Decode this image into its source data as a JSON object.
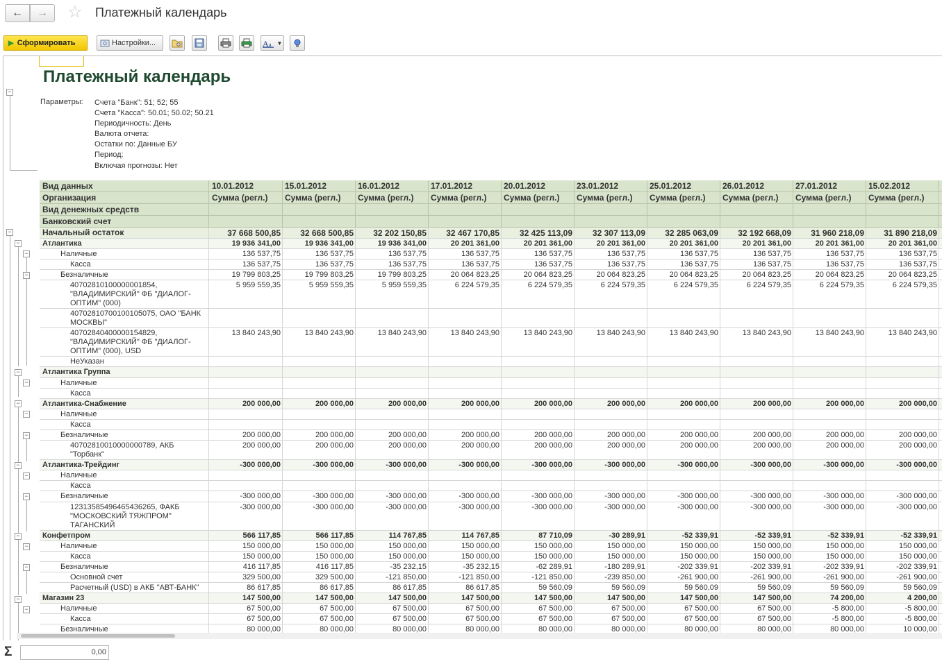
{
  "window": {
    "title": "Платежный календарь",
    "back_icon": "←",
    "fwd_icon": "→",
    "star_icon": "☆"
  },
  "toolbar": {
    "form_label": "Сформировать",
    "settings_label": "Настройки..."
  },
  "report": {
    "title": "Платежный календарь",
    "params_label": "Параметры:",
    "params": [
      "Счета \"Банк\": 51; 52; 55",
      "Счета \"Касса\": 50.01; 50.02; 50.21",
      "Периодичность: День",
      "Валюта отчета:",
      "Остатки по: Данные БУ",
      "Период:",
      "Включая прогнозы: Нет"
    ],
    "header": {
      "labels": [
        "Вид данных",
        "Организация",
        "Вид денежных средств",
        "Банковский счет"
      ],
      "dates": [
        "10.01.2012",
        "15.01.2012",
        "16.01.2012",
        "17.01.2012",
        "20.01.2012",
        "23.01.2012",
        "25.01.2012",
        "26.01.2012",
        "27.01.2012",
        "15.02.2012"
      ],
      "sum_label": "Сумма (регл.)"
    },
    "rows": [
      {
        "label": "Начальный остаток",
        "type": "tot",
        "values": [
          "37 668 500,85",
          "32 668 500,85",
          "32 202 150,85",
          "32 467 170,85",
          "32 425 113,09",
          "32 307 113,09",
          "32 285 063,09",
          "32 192 668,09",
          "31 960 218,09",
          "31 890 218,09"
        ]
      },
      {
        "label": "Атлантика",
        "type": "org",
        "values": [
          "19 936 341,00",
          "19 936 341,00",
          "19 936 341,00",
          "20 201 361,00",
          "20 201 361,00",
          "20 201 361,00",
          "20 201 361,00",
          "20 201 361,00",
          "20 201 361,00",
          "20 201 361,00"
        ]
      },
      {
        "label": "Наличные",
        "type": "sub",
        "values": [
          "136 537,75",
          "136 537,75",
          "136 537,75",
          "136 537,75",
          "136 537,75",
          "136 537,75",
          "136 537,75",
          "136 537,75",
          "136 537,75",
          "136 537,75"
        ]
      },
      {
        "label": "Касса",
        "type": "det",
        "values": [
          "136 537,75",
          "136 537,75",
          "136 537,75",
          "136 537,75",
          "136 537,75",
          "136 537,75",
          "136 537,75",
          "136 537,75",
          "136 537,75",
          "136 537,75"
        ]
      },
      {
        "label": "Безналичные",
        "type": "sub",
        "values": [
          "19 799 803,25",
          "19 799 803,25",
          "19 799 803,25",
          "20 064 823,25",
          "20 064 823,25",
          "20 064 823,25",
          "20 064 823,25",
          "20 064 823,25",
          "20 064 823,25",
          "20 064 823,25"
        ]
      },
      {
        "label": "40702810100000001854, \"ВЛАДИМИРСКИЙ\" ФБ \"ДИАЛОГ-ОПТИМ\" (000)",
        "type": "det",
        "lines": 3,
        "values": [
          "5 959 559,35",
          "5 959 559,35",
          "5 959 559,35",
          "6 224 579,35",
          "6 224 579,35",
          "6 224 579,35",
          "6 224 579,35",
          "6 224 579,35",
          "6 224 579,35",
          "6 224 579,35"
        ]
      },
      {
        "label": "40702810700100105075, ОАО \"БАНК МОСКВЫ\"",
        "type": "det",
        "lines": 2,
        "values": [
          "",
          "",
          "",
          "",
          "",
          "",
          "",
          "",
          "",
          ""
        ]
      },
      {
        "label": "40702840400000154829, \"ВЛАДИМИРСКИЙ\" ФБ \"ДИАЛОГ-ОПТИМ\" (000), USD",
        "type": "det",
        "lines": 3,
        "values": [
          "13 840 243,90",
          "13 840 243,90",
          "13 840 243,90",
          "13 840 243,90",
          "13 840 243,90",
          "13 840 243,90",
          "13 840 243,90",
          "13 840 243,90",
          "13 840 243,90",
          "13 840 243,90"
        ]
      },
      {
        "label": "НеУказан",
        "type": "det",
        "values": [
          "",
          "",
          "",
          "",
          "",
          "",
          "",
          "",
          "",
          ""
        ]
      },
      {
        "label": "Атлантика Группа",
        "type": "org",
        "values": [
          "",
          "",
          "",
          "",
          "",
          "",
          "",
          "",
          "",
          ""
        ]
      },
      {
        "label": "Наличные",
        "type": "sub",
        "values": [
          "",
          "",
          "",
          "",
          "",
          "",
          "",
          "",
          "",
          ""
        ]
      },
      {
        "label": "Касса",
        "type": "det",
        "values": [
          "",
          "",
          "",
          "",
          "",
          "",
          "",
          "",
          "",
          ""
        ]
      },
      {
        "label": "Атлантика-Снабжение",
        "type": "org",
        "values": [
          "200 000,00",
          "200 000,00",
          "200 000,00",
          "200 000,00",
          "200 000,00",
          "200 000,00",
          "200 000,00",
          "200 000,00",
          "200 000,00",
          "200 000,00"
        ]
      },
      {
        "label": "Наличные",
        "type": "sub",
        "values": [
          "",
          "",
          "",
          "",
          "",
          "",
          "",
          "",
          "",
          ""
        ]
      },
      {
        "label": "Касса",
        "type": "det",
        "values": [
          "",
          "",
          "",
          "",
          "",
          "",
          "",
          "",
          "",
          ""
        ]
      },
      {
        "label": "Безналичные",
        "type": "sub",
        "values": [
          "200 000,00",
          "200 000,00",
          "200 000,00",
          "200 000,00",
          "200 000,00",
          "200 000,00",
          "200 000,00",
          "200 000,00",
          "200 000,00",
          "200 000,00"
        ]
      },
      {
        "label": "40702810010000000789, АКБ \"Торбанк\"",
        "type": "det",
        "lines": 2,
        "values": [
          "200 000,00",
          "200 000,00",
          "200 000,00",
          "200 000,00",
          "200 000,00",
          "200 000,00",
          "200 000,00",
          "200 000,00",
          "200 000,00",
          "200 000,00"
        ]
      },
      {
        "label": "Атлантика-Трейдинг",
        "type": "org",
        "values": [
          "-300 000,00",
          "-300 000,00",
          "-300 000,00",
          "-300 000,00",
          "-300 000,00",
          "-300 000,00",
          "-300 000,00",
          "-300 000,00",
          "-300 000,00",
          "-300 000,00"
        ]
      },
      {
        "label": "Наличные",
        "type": "sub",
        "values": [
          "",
          "",
          "",
          "",
          "",
          "",
          "",
          "",
          "",
          ""
        ]
      },
      {
        "label": "Касса",
        "type": "det",
        "values": [
          "",
          "",
          "",
          "",
          "",
          "",
          "",
          "",
          "",
          ""
        ]
      },
      {
        "label": "Безналичные",
        "type": "sub",
        "values": [
          "-300 000,00",
          "-300 000,00",
          "-300 000,00",
          "-300 000,00",
          "-300 000,00",
          "-300 000,00",
          "-300 000,00",
          "-300 000,00",
          "-300 000,00",
          "-300 000,00"
        ]
      },
      {
        "label": "12313585496465436265, ФАКБ \"МОСКОВСКИЙ ТЯЖПРОМ\" ТАГАНСКИЙ",
        "type": "det",
        "lines": 3,
        "values": [
          "-300 000,00",
          "-300 000,00",
          "-300 000,00",
          "-300 000,00",
          "-300 000,00",
          "-300 000,00",
          "-300 000,00",
          "-300 000,00",
          "-300 000,00",
          "-300 000,00"
        ]
      },
      {
        "label": "Конфетпром",
        "type": "org",
        "values": [
          "566 117,85",
          "566 117,85",
          "114 767,85",
          "114 767,85",
          "87 710,09",
          "-30 289,91",
          "-52 339,91",
          "-52 339,91",
          "-52 339,91",
          "-52 339,91"
        ]
      },
      {
        "label": "Наличные",
        "type": "sub",
        "values": [
          "150 000,00",
          "150 000,00",
          "150 000,00",
          "150 000,00",
          "150 000,00",
          "150 000,00",
          "150 000,00",
          "150 000,00",
          "150 000,00",
          "150 000,00"
        ]
      },
      {
        "label": "Касса",
        "type": "det",
        "values": [
          "150 000,00",
          "150 000,00",
          "150 000,00",
          "150 000,00",
          "150 000,00",
          "150 000,00",
          "150 000,00",
          "150 000,00",
          "150 000,00",
          "150 000,00"
        ]
      },
      {
        "label": "Безналичные",
        "type": "sub",
        "values": [
          "416 117,85",
          "416 117,85",
          "-35 232,15",
          "-35 232,15",
          "-62 289,91",
          "-180 289,91",
          "-202 339,91",
          "-202 339,91",
          "-202 339,91",
          "-202 339,91"
        ]
      },
      {
        "label": "Основной счет",
        "type": "det",
        "values": [
          "329 500,00",
          "329 500,00",
          "-121 850,00",
          "-121 850,00",
          "-121 850,00",
          "-239 850,00",
          "-261 900,00",
          "-261 900,00",
          "-261 900,00",
          "-261 900,00"
        ]
      },
      {
        "label": "Расчетный (USD) в АКБ \"АВТ-БАНК\"",
        "type": "det",
        "values": [
          "86 617,85",
          "86 617,85",
          "86 617,85",
          "86 617,85",
          "59 560,09",
          "59 560,09",
          "59 560,09",
          "59 560,09",
          "59 560,09",
          "59 560,09"
        ]
      },
      {
        "label": "Магазин 23",
        "type": "org",
        "values": [
          "147 500,00",
          "147 500,00",
          "147 500,00",
          "147 500,00",
          "147 500,00",
          "147 500,00",
          "147 500,00",
          "147 500,00",
          "74 200,00",
          "4 200,00"
        ]
      },
      {
        "label": "Наличные",
        "type": "sub",
        "values": [
          "67 500,00",
          "67 500,00",
          "67 500,00",
          "67 500,00",
          "67 500,00",
          "67 500,00",
          "67 500,00",
          "67 500,00",
          "-5 800,00",
          "-5 800,00"
        ]
      },
      {
        "label": "Касса",
        "type": "det",
        "values": [
          "67 500,00",
          "67 500,00",
          "67 500,00",
          "67 500,00",
          "67 500,00",
          "67 500,00",
          "67 500,00",
          "67 500,00",
          "-5 800,00",
          "-5 800,00"
        ]
      },
      {
        "label": "Безналичные",
        "type": "sub",
        "values": [
          "80 000,00",
          "80 000,00",
          "80 000,00",
          "80 000,00",
          "80 000,00",
          "80 000,00",
          "80 000,00",
          "80 000,00",
          "80 000,00",
          "10 000,00"
        ]
      }
    ]
  },
  "footer": {
    "sum_icon": "Σ",
    "sum_value": "0,00"
  }
}
